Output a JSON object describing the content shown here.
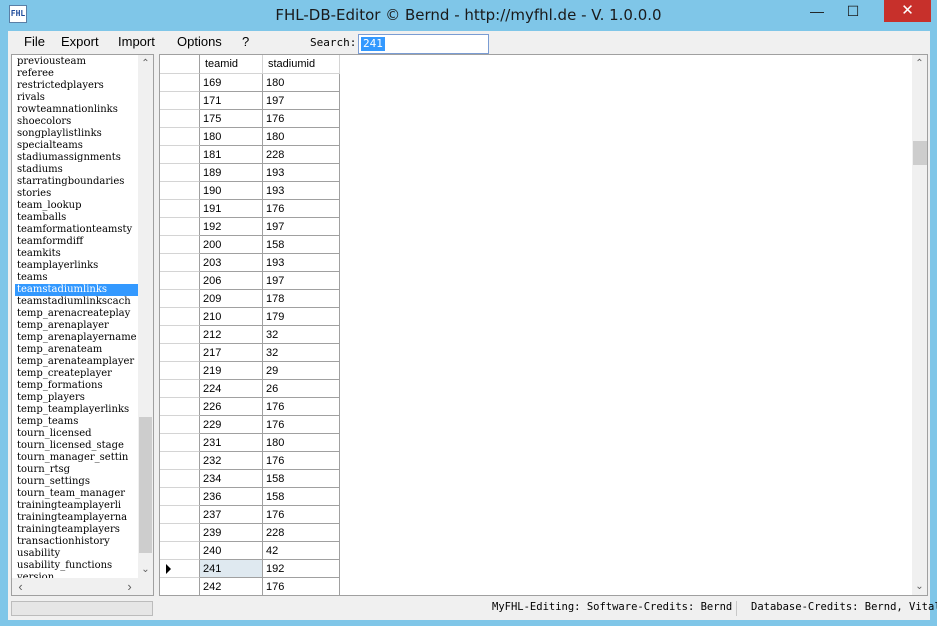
{
  "window": {
    "title": "FHL-DB-Editor © Bernd - http://myfhl.de - V. 1.0.0.0",
    "app_icon_text": "FHL",
    "minimize_glyph": "—",
    "maximize_glyph": "☐",
    "close_glyph": "✕"
  },
  "menu": {
    "items": [
      "File",
      "Export",
      "Import",
      "Options",
      "?"
    ],
    "search_label": "Search:",
    "search_value": "241"
  },
  "table_list": {
    "items": [
      "previousteam",
      "referee",
      "restrictedplayers",
      "rivals",
      "rowteamnationlinks",
      "shoecolors",
      "songplaylistlinks",
      "specialteams",
      "stadiumassignments",
      "stadiums",
      "starratingboundaries",
      "stories",
      "team_lookup",
      "teamballs",
      "teamformationteamsty",
      "teamformdiff",
      "teamkits",
      "teamplayerlinks",
      "teams",
      "teamstadiumlinks",
      "teamstadiumlinkscach",
      "temp_arenacreateplay",
      "temp_arenaplayer",
      "temp_arenaplayername",
      "temp_arenateam",
      "temp_arenateamplayer",
      "temp_createplayer",
      "temp_formations",
      "temp_players",
      "temp_teamplayerlinks",
      "temp_teams",
      "tourn_licensed",
      "tourn_licensed_stage",
      "tourn_manager_settin",
      "tourn_rtsg",
      "tourn_settings",
      "tourn_team_manager",
      "trainingteamplayerli",
      "trainingteamplayerna",
      "trainingteamplayers",
      "transactionhistory",
      "usability",
      "usability_functions",
      "version"
    ],
    "selected": "teamstadiumlinks",
    "arrow_up": "⌃",
    "arrow_down": "⌄",
    "arrow_left": "‹",
    "arrow_right": "›"
  },
  "grid": {
    "columns": [
      "teamid",
      "stadiumid"
    ],
    "rows": [
      [
        "169",
        "180"
      ],
      [
        "171",
        "197"
      ],
      [
        "175",
        "176"
      ],
      [
        "180",
        "180"
      ],
      [
        "181",
        "228"
      ],
      [
        "189",
        "193"
      ],
      [
        "190",
        "193"
      ],
      [
        "191",
        "176"
      ],
      [
        "192",
        "197"
      ],
      [
        "200",
        "158"
      ],
      [
        "203",
        "193"
      ],
      [
        "206",
        "197"
      ],
      [
        "209",
        "178"
      ],
      [
        "210",
        "179"
      ],
      [
        "212",
        "32"
      ],
      [
        "217",
        "32"
      ],
      [
        "219",
        "29"
      ],
      [
        "224",
        "26"
      ],
      [
        "226",
        "176"
      ],
      [
        "229",
        "176"
      ],
      [
        "231",
        "180"
      ],
      [
        "232",
        "176"
      ],
      [
        "234",
        "158"
      ],
      [
        "236",
        "158"
      ],
      [
        "237",
        "176"
      ],
      [
        "239",
        "228"
      ],
      [
        "240",
        "42"
      ],
      [
        "241",
        "192"
      ],
      [
        "242",
        "176"
      ]
    ],
    "current_row_index": 27,
    "arrow_up": "⌃",
    "arrow_down": "⌄"
  },
  "status": {
    "software_credits": "MyFHL-Editing: Software-Credits: Bernd",
    "database_credits": "Database-Credits: Bernd, Vital"
  }
}
